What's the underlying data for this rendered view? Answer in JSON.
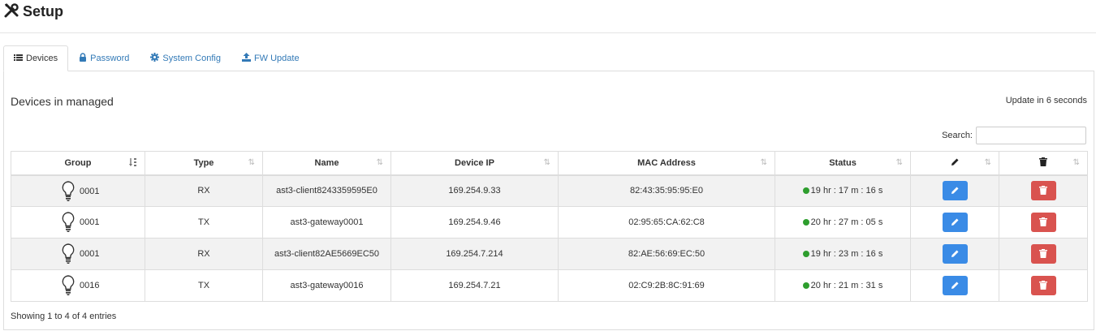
{
  "header": {
    "title": "Setup"
  },
  "tabs": [
    {
      "label": "Devices",
      "icon": "list-icon",
      "active": true
    },
    {
      "label": "Password",
      "icon": "lock-icon",
      "active": false
    },
    {
      "label": "System Config",
      "icon": "gear-icon",
      "active": false
    },
    {
      "label": "FW Update",
      "icon": "upload-icon",
      "active": false
    }
  ],
  "panel": {
    "title": "Devices in managed",
    "update_text": "Update in 6 seconds",
    "search_label": "Search:",
    "search_value": ""
  },
  "table": {
    "columns": [
      "Group",
      "Type",
      "Name",
      "Device IP",
      "MAC Address",
      "Status"
    ],
    "rows": [
      {
        "group": "0001",
        "type": "RX",
        "name": "ast3-client8243359595E0",
        "ip": "169.254.9.33",
        "mac": "82:43:35:95:95:E0",
        "status": "19 hr : 17 m : 16 s"
      },
      {
        "group": "0001",
        "type": "TX",
        "name": "ast3-gateway0001",
        "ip": "169.254.9.46",
        "mac": "02:95:65:CA:62:C8",
        "status": "20 hr : 27 m : 05 s"
      },
      {
        "group": "0001",
        "type": "RX",
        "name": "ast3-client82AE5669EC50",
        "ip": "169.254.7.214",
        "mac": "82:AE:56:69:EC:50",
        "status": "19 hr : 23 m : 16 s"
      },
      {
        "group": "0016",
        "type": "TX",
        "name": "ast3-gateway0016",
        "ip": "169.254.7.21",
        "mac": "02:C9:2B:8C:91:69",
        "status": "20 hr : 21 m : 31 s"
      }
    ]
  },
  "footer": {
    "info": "Showing 1 to 4 of 4 entries"
  },
  "colors": {
    "accent": "#337ab7",
    "edit": "#3a8be6",
    "delete": "#d9534f",
    "status_ok": "#2e9e2e"
  }
}
